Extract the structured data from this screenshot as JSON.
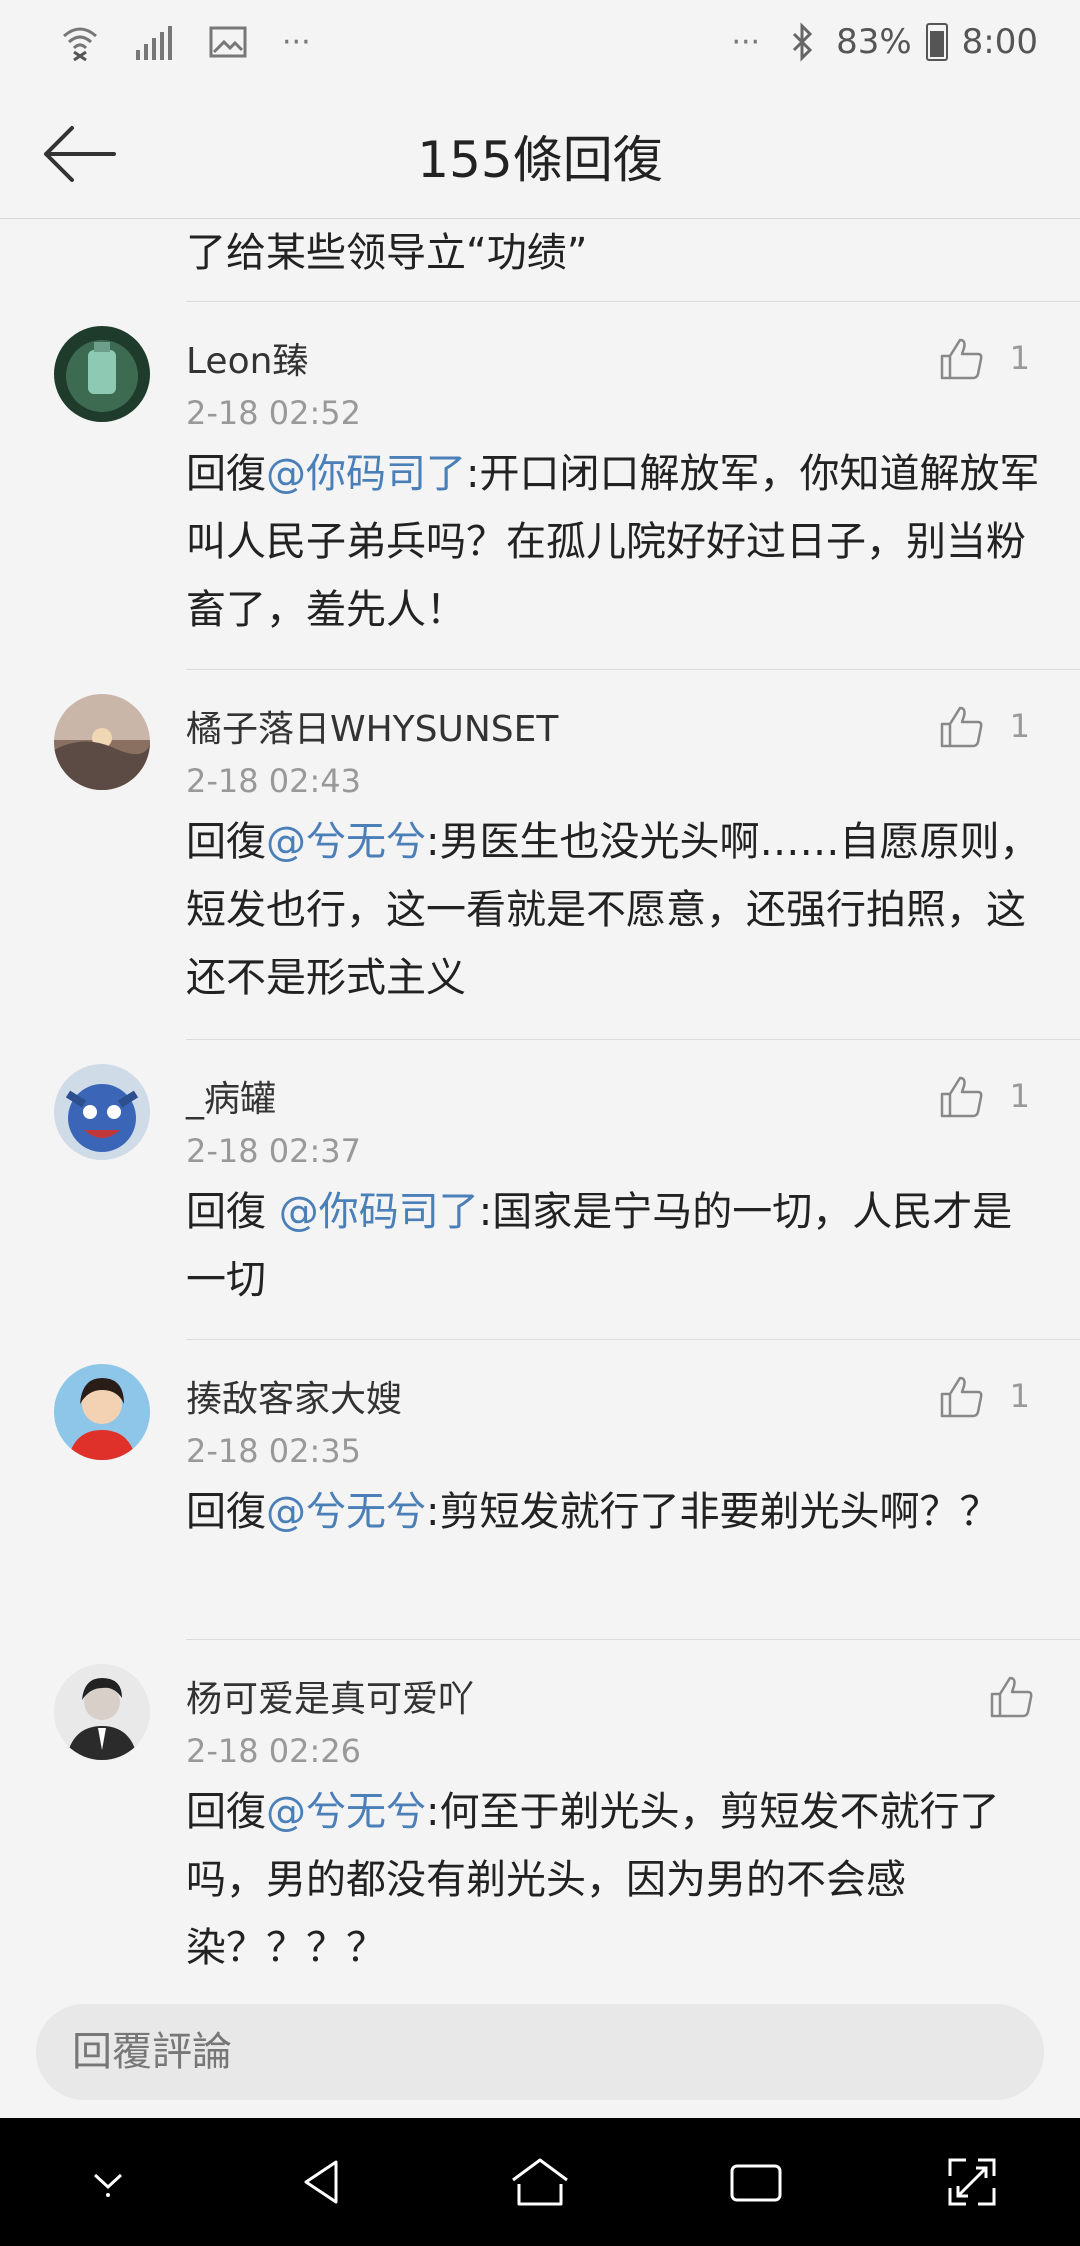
{
  "status_bar": {
    "left_icons": [
      "wifi-icon",
      "signal-icon",
      "image-icon",
      "more-icon"
    ],
    "more_left": "···",
    "more_right": "···",
    "battery_percent": "83%",
    "time": "8:00",
    "right_icons": [
      "bluetooth-icon",
      "battery-icon"
    ]
  },
  "header": {
    "title": "155條回復",
    "back_icon": "arrow-left-icon"
  },
  "previous_comment_tail": "了给某些领导立“功绩”",
  "comments": [
    {
      "username": "Leon臻",
      "time": "2-18 02:52",
      "likes": "1",
      "reply_prefix": "回復",
      "mention": "@你码司了",
      "text": ":开口闭口解放军，你知道解放军叫人民子弟兵吗？在孤儿院好好过日子，别当粉畜了，羞先人！"
    },
    {
      "username": "橘子落日WHYSUNSET",
      "time": "2-18 02:43",
      "likes": "1",
      "reply_prefix": "回復",
      "mention": "@兮无兮",
      "text": ":男医生也没光头啊……自愿原则，短发也行，这一看就是不愿意，还强行拍照，这还不是形式主义"
    },
    {
      "username": "_病罐",
      "time": "2-18 02:37",
      "likes": "1",
      "reply_prefix": "回復 ",
      "mention": "@你码司了",
      "text": ":国家是宁马的一切，人民才是一切"
    },
    {
      "username": "揍敌客家大嫂",
      "time": "2-18 02:35",
      "likes": "1",
      "reply_prefix": "回復",
      "mention": "@兮无兮",
      "text": ":剪短发就行了非要剃光头啊？？"
    },
    {
      "username": "杨可爱是真可爱吖",
      "time": "2-18 02:26",
      "likes": "",
      "reply_prefix": "回復",
      "mention": "@兮无兮",
      "text": ":何至于剃光头，剪短发不就行了吗，男的都没有剃光头，因为男的不会感染？？？？"
    }
  ],
  "reply_input": {
    "placeholder": "回覆評論"
  },
  "nav": [
    "chevron-down-icon",
    "back-triangle-icon",
    "home-icon",
    "recents-icon",
    "expand-icon"
  ],
  "colors": {
    "background": "#f4f4f4",
    "mention": "#4a7fb8",
    "meta": "#999999",
    "nav_bar": "#000000"
  }
}
